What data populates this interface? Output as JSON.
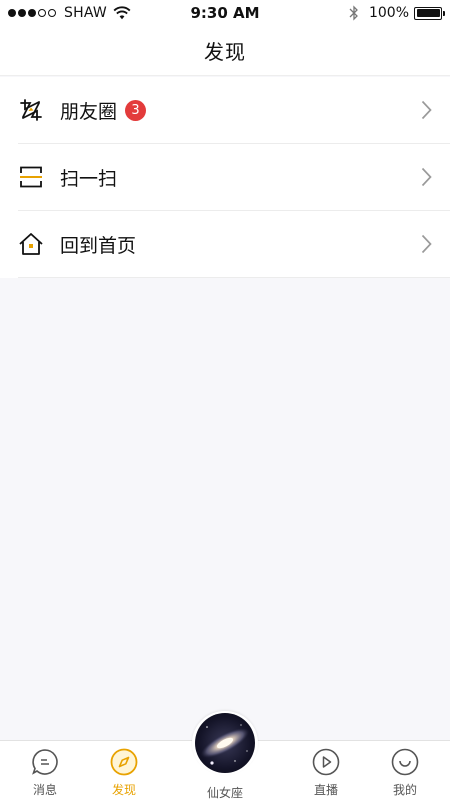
{
  "status_bar": {
    "carrier": "SHAW",
    "time": "9:30 AM",
    "battery_percent": "100%",
    "battery_level": 1.0
  },
  "nav": {
    "title": "发现"
  },
  "menu": [
    {
      "label": "朋友圈",
      "badge": "3",
      "icon": "moments-icon"
    },
    {
      "label": "扫一扫",
      "icon": "scan-icon"
    },
    {
      "label": "回到首页",
      "icon": "home-icon"
    }
  ],
  "tabs": [
    {
      "label": "消息",
      "icon": "message-icon"
    },
    {
      "label": "发现",
      "icon": "compass-icon",
      "active": true
    },
    {
      "label": "仙女座",
      "icon": "galaxy-icon"
    },
    {
      "label": "直播",
      "icon": "play-icon"
    },
    {
      "label": "我的",
      "icon": "profile-icon"
    }
  ],
  "colors": {
    "accent": "#e8a200",
    "badge": "#e33b3b",
    "background": "#f7f7fa"
  }
}
